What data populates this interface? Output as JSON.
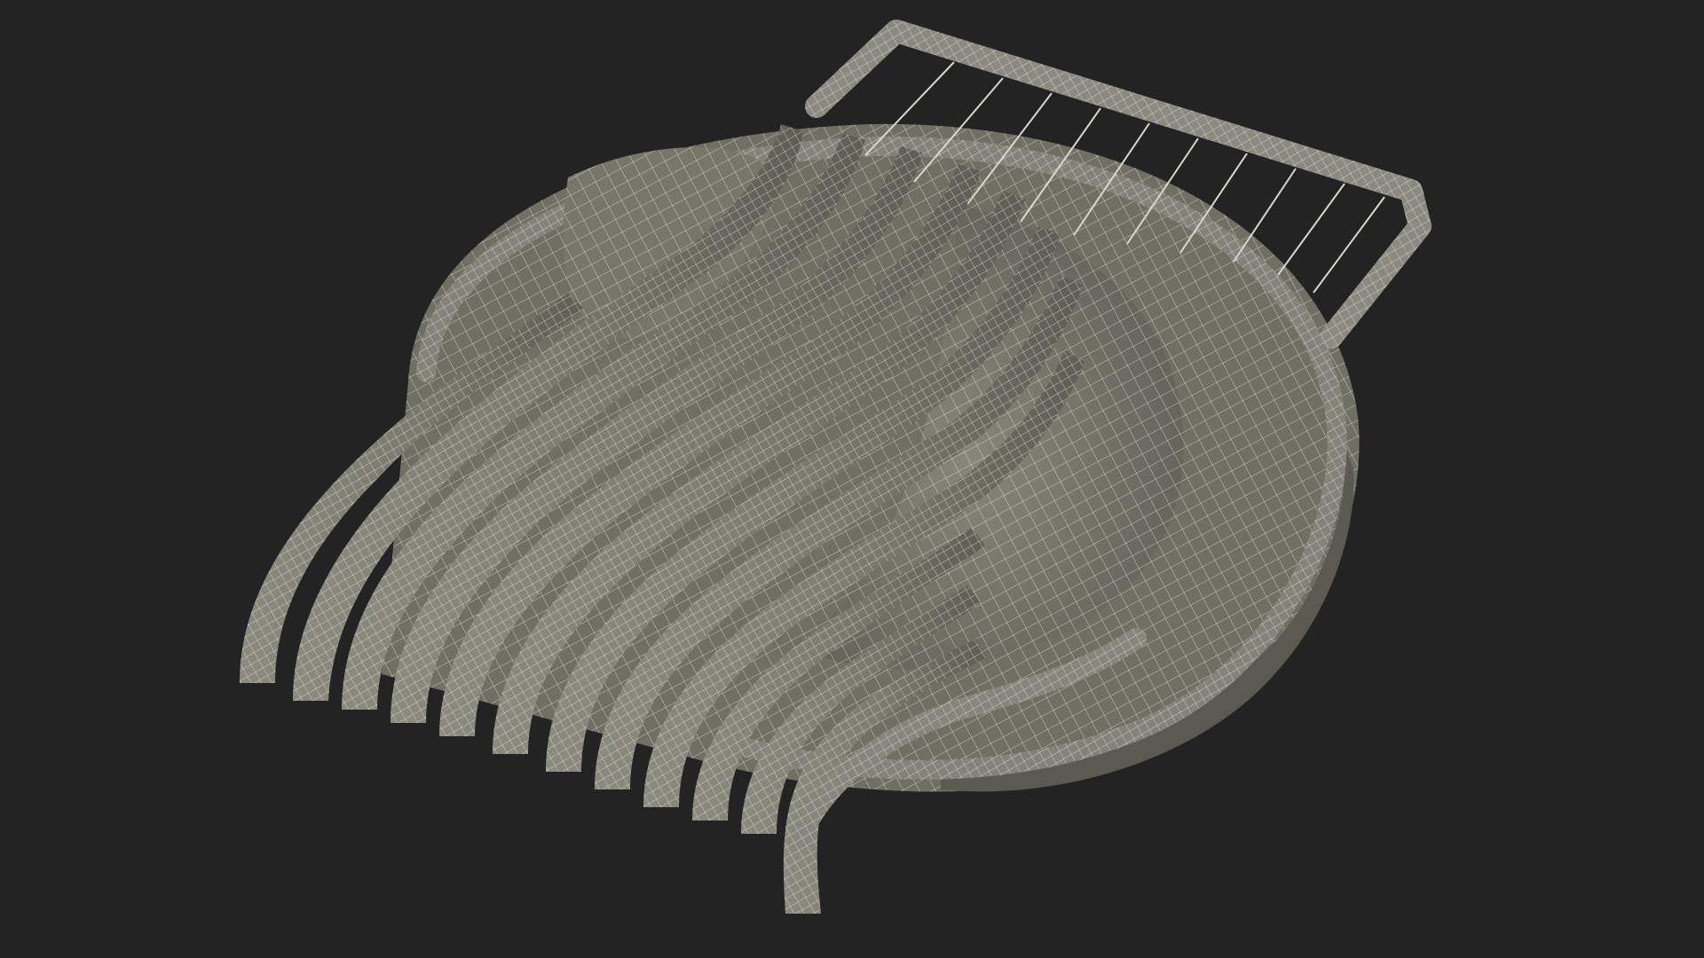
{
  "viewport": {
    "background_color": "#232323",
    "object_name": "egg-slicer-wireframe",
    "render_style": "wireframe",
    "surface_color": "#7e7e72",
    "surface_shadow_color": "#55554c",
    "wire_color": "#f2f2e6",
    "cutting_wire_color": "#d8d8cc"
  },
  "slicer": {
    "blade_count": 12,
    "cutting_wire_count": 10
  }
}
